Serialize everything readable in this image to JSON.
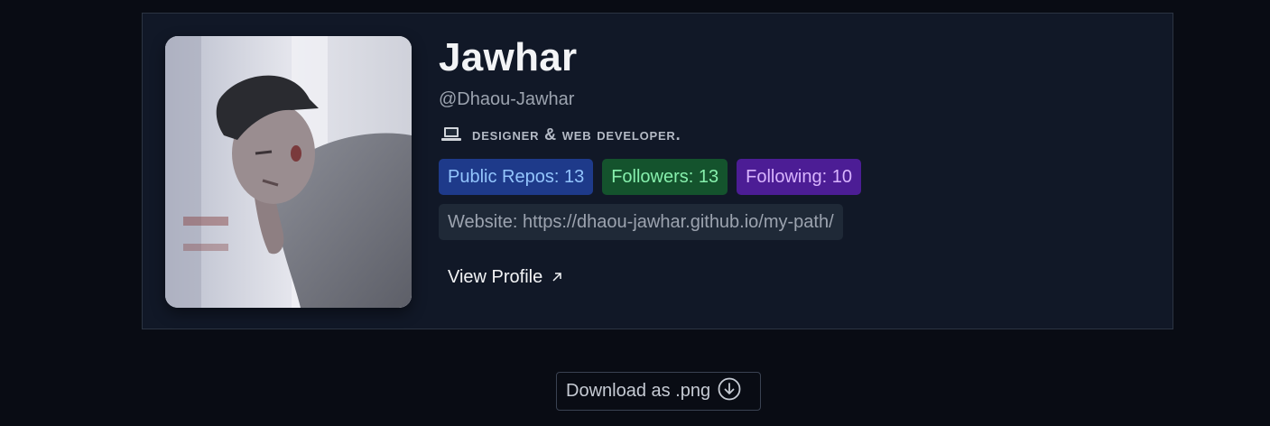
{
  "profile": {
    "name": "Jawhar",
    "handle": "@Dhaou-Jawhar",
    "bio_icon": "laptop-icon",
    "bio": "Designer & Web developer.",
    "stats": {
      "repos_label": "Public Repos: 13",
      "followers_label": "Followers: 13",
      "following_label": "Following: 10"
    },
    "website_label": "Website:",
    "website_url": "https://dhaou-jawhar.github.io/my-path/",
    "view_profile_label": "View Profile",
    "view_profile_icon": "external-arrow-icon"
  },
  "download": {
    "label": "Download as .png",
    "icon": "download-circle-icon"
  },
  "colors": {
    "page_bg": "#090c14",
    "card_bg": "#111827",
    "repos_badge": "#1e3a8a",
    "followers_badge": "#14532d",
    "following_badge": "#4c1d95",
    "website_badge": "#1f2937"
  }
}
